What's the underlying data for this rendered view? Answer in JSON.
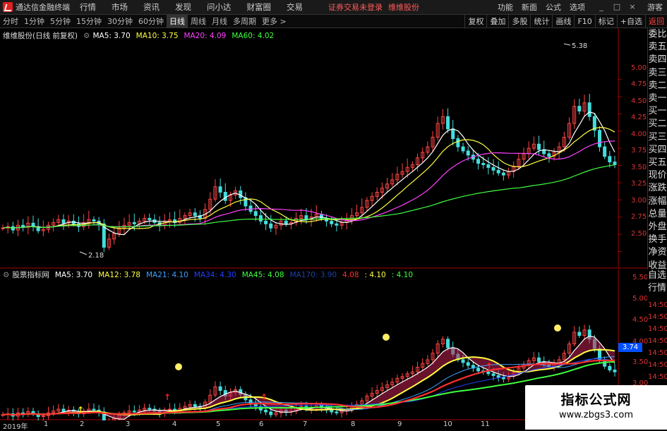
{
  "app": {
    "title": "通达信金融终端",
    "menus": [
      "行情",
      "市场",
      "资讯",
      "发现",
      "问小达",
      "财富圈",
      "交易"
    ],
    "warning": "证券交易未登录",
    "stock_short": "维维股份",
    "right_menus": [
      "功能",
      "新面",
      "公式",
      "选项"
    ],
    "guest": "游客",
    "win_min": "_",
    "win_max": "□",
    "win_close": "×"
  },
  "toolbar": {
    "periods": [
      "分时",
      "1分钟",
      "5分钟",
      "15分钟",
      "30分钟",
      "60分钟",
      "日线",
      "周线",
      "月线",
      "多周期",
      "更多 >"
    ],
    "active_period": "日线",
    "right_buttons": [
      "复权",
      "叠加",
      "多股",
      "统计",
      "画线",
      "F10",
      "标记",
      "+自选",
      "返回"
    ]
  },
  "main_legend": {
    "name": "维维股份(日线 前复权)",
    "items": [
      {
        "text": "MA5: 3.70",
        "color": "#ffffff"
      },
      {
        "text": "MA10: 3.75",
        "color": "#ffff40"
      },
      {
        "text": "MA20: 4.09",
        "color": "#ff40ff"
      },
      {
        "text": "MA60: 4.02",
        "color": "#40ff40"
      }
    ]
  },
  "sub_legend": {
    "name": "股票指标网",
    "items": [
      {
        "text": "MA5: 3.70",
        "color": "#ffffff"
      },
      {
        "text": "MA12: 3.78",
        "color": "#ffff40"
      },
      {
        "text": "MA21: 4.10",
        "color": "#40a0ff"
      },
      {
        "text": "MA34: 4.30",
        "color": "#2040ff"
      },
      {
        "text": "MA45: 4.08",
        "color": "#40ff40"
      },
      {
        "text": "MA170: 3.90",
        "color": "#2040a0"
      },
      {
        "text": "4.08",
        "color": "#ff3030"
      },
      {
        "text": ": 4.10",
        "color": "#ffff40"
      },
      {
        "text": ": 4.10",
        "color": "#40ff40"
      }
    ]
  },
  "side_panel": [
    "委比",
    "卖五",
    "卖四",
    "卖三",
    "卖二",
    "卖一",
    "买一",
    "买二",
    "买三",
    "买四",
    "买五",
    "现价",
    "涨跌",
    "涨幅",
    "总量",
    "外盘",
    "换手",
    "净资",
    "收益"
  ],
  "side_panel2": [
    "自选",
    "行情"
  ],
  "main_axis": [
    "5.00",
    "4.75",
    "4.50",
    "4.25",
    "4.00",
    "3.75",
    "3.50",
    "3.25",
    "3.00",
    "2.75",
    "2.50"
  ],
  "sub_axis": [
    "5.50",
    "5.00",
    "4.50",
    "4.00",
    "3.50",
    "3.00"
  ],
  "sub_axis_time": [
    "14:50",
    "14:50",
    "14:50",
    "14:50",
    "14:50",
    "14:50",
    "14:50",
    "14:50"
  ],
  "price_box": "3.74",
  "annotations": {
    "high": "5.38",
    "low": "2.18"
  },
  "x_labels": [
    "2019年",
    "1",
    "2",
    "3",
    "4",
    "5",
    "6",
    "7",
    "8",
    "9",
    "10",
    "11"
  ],
  "watermark": {
    "line1": "指标公式网",
    "line2": "www.zbgs3.com"
  },
  "chart_data": {
    "type": "line",
    "series_name": "维维股份",
    "ylim": [
      2.3,
      5.5
    ],
    "close": [
      2.78,
      2.8,
      2.75,
      2.82,
      2.79,
      2.85,
      2.8,
      2.74,
      2.76,
      2.82,
      2.86,
      2.9,
      2.85,
      2.88,
      2.84,
      2.8,
      2.86,
      2.9,
      2.88,
      2.84,
      2.5,
      2.62,
      2.7,
      2.78,
      2.82,
      2.86,
      2.84,
      2.88,
      2.92,
      2.9,
      2.86,
      2.82,
      2.88,
      2.9,
      2.86,
      2.92,
      2.96,
      3.0,
      2.96,
      2.92,
      3.05,
      3.2,
      3.38,
      3.3,
      3.18,
      3.26,
      3.32,
      3.22,
      3.1,
      3.02,
      2.96,
      2.88,
      2.84,
      2.78,
      2.82,
      2.88,
      2.84,
      2.86,
      2.92,
      2.96,
      2.9,
      2.94,
      2.98,
      2.92,
      2.88,
      2.84,
      2.82,
      2.86,
      2.9,
      2.96,
      3.0,
      3.08,
      3.18,
      3.24,
      3.3,
      3.36,
      3.42,
      3.48,
      3.56,
      3.6,
      3.66,
      3.7,
      3.8,
      3.88,
      3.96,
      4.1,
      4.3,
      4.4,
      4.22,
      4.08,
      3.96,
      3.9,
      3.84,
      3.78,
      3.72,
      3.7,
      3.66,
      3.62,
      3.58,
      3.55,
      3.6,
      3.68,
      3.78,
      3.86,
      3.94,
      4.0,
      3.92,
      3.86,
      3.82,
      3.88,
      3.96,
      4.1,
      4.3,
      4.55,
      4.48,
      4.6,
      4.4,
      4.2,
      3.96,
      3.82,
      3.74,
      3.7
    ]
  }
}
